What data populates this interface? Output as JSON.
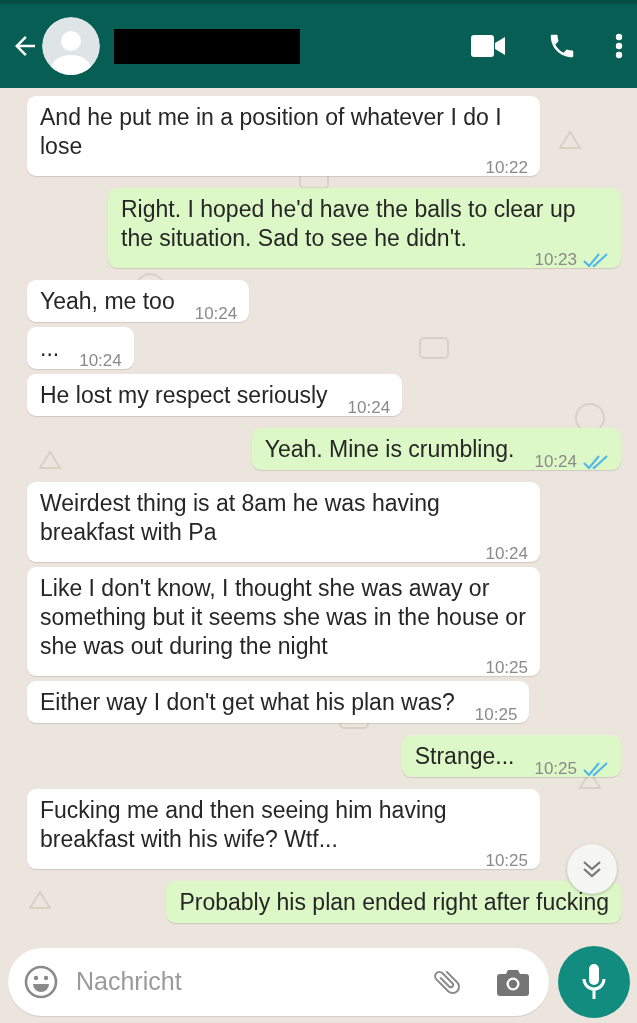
{
  "header": {
    "name_redacted": true
  },
  "messages": [
    {
      "outgoing": false,
      "text": "And he put me in a position of whatever I do I lose",
      "time": "10:22"
    },
    {
      "outgoing": true,
      "text": "Right. I hoped he'd have the balls to clear up the situation. Sad to see he didn't.",
      "time": "10:23",
      "read": true
    },
    {
      "outgoing": false,
      "text": "Yeah, me too",
      "time": "10:24"
    },
    {
      "outgoing": false,
      "text": "...",
      "time": "10:24"
    },
    {
      "outgoing": false,
      "text": "He lost my respect seriously",
      "time": "10:24"
    },
    {
      "outgoing": true,
      "text": "Yeah. Mine is crumbling.",
      "time": "10:24",
      "read": true
    },
    {
      "outgoing": false,
      "text": "Weirdest thing is at 8am he was having breakfast with Pa",
      "time": "10:24"
    },
    {
      "outgoing": false,
      "text": "Like I don't know, I thought she was away or something but it seems she was in the house or she was out during the night",
      "time": "10:25"
    },
    {
      "outgoing": false,
      "text": "Either way I don't get what his plan was?",
      "time": "10:25"
    },
    {
      "outgoing": true,
      "text": "Strange...",
      "time": "10:25",
      "read": true
    },
    {
      "outgoing": false,
      "text": "Fucking me and then seeing him having breakfast with his wife? Wtf...",
      "time": "10:25"
    },
    {
      "outgoing": true,
      "text": "Probably his plan ended right after fucking"
    }
  ],
  "composer": {
    "placeholder": "Nachricht"
  }
}
